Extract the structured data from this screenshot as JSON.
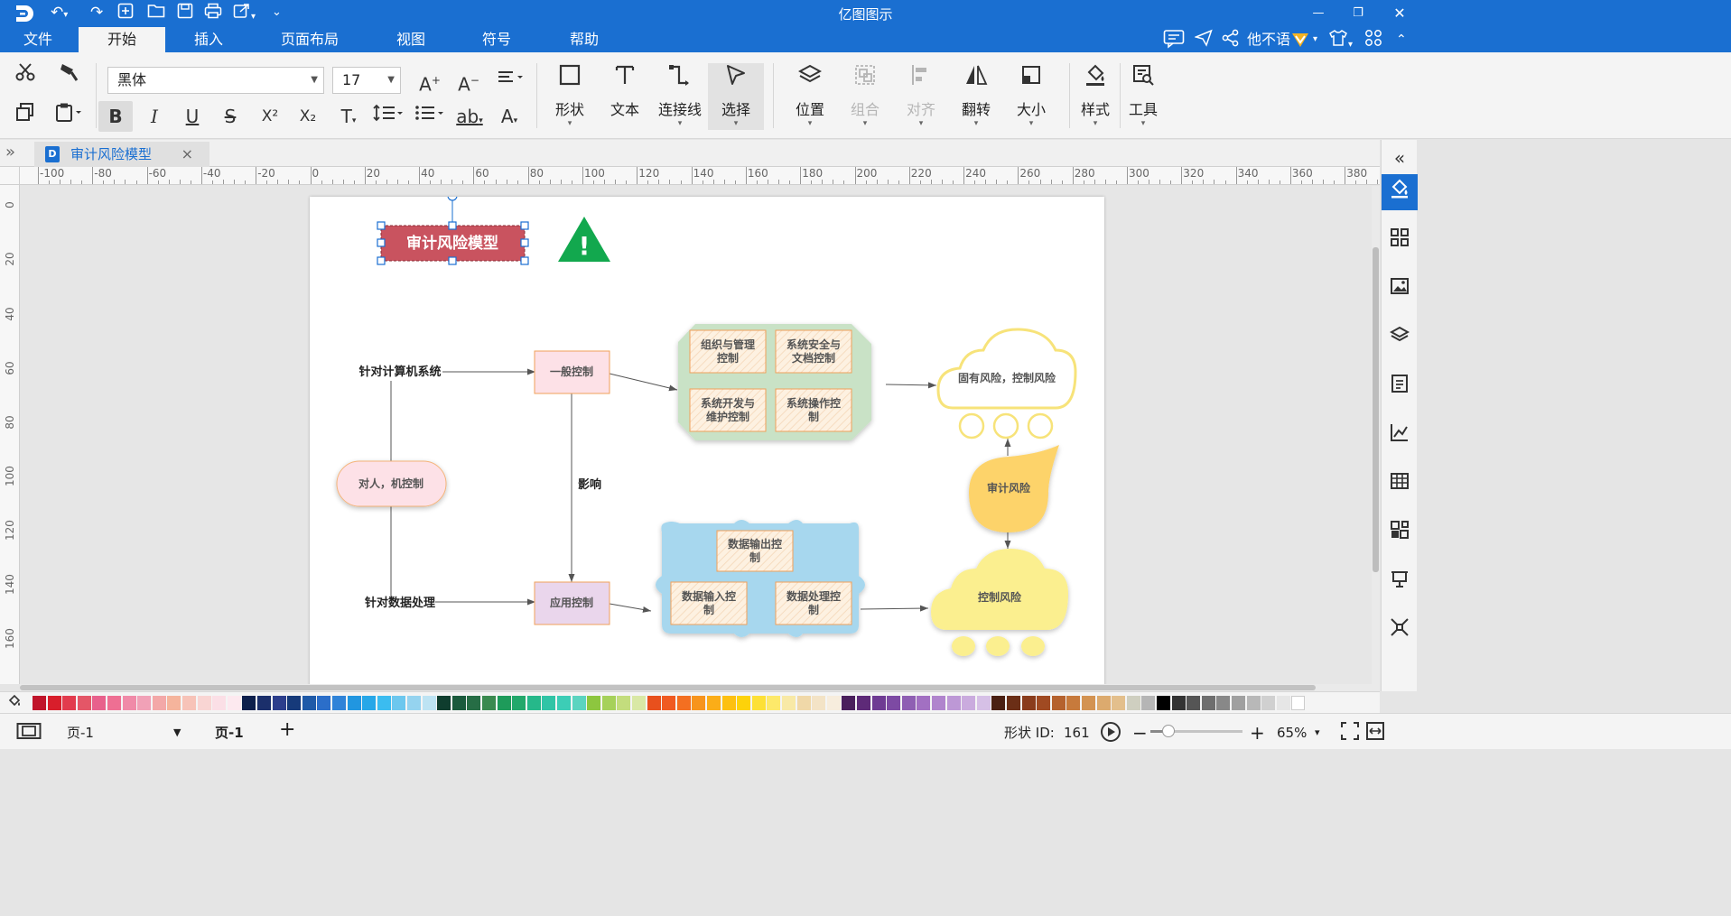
{
  "titlebar": {
    "title": "亿图图示"
  },
  "menu": {
    "items": [
      "文件",
      "开始",
      "插入",
      "页面布局",
      "视图",
      "符号",
      "帮助"
    ],
    "active_index": 1,
    "user_name": "他不语"
  },
  "ribbon": {
    "font_family": "黑体",
    "font_size": "17",
    "big_buttons": {
      "shape": "形状",
      "text": "文本",
      "connector": "连接线",
      "select": "选择",
      "position": "位置",
      "group": "组合",
      "align": "对齐",
      "flip": "翻转",
      "size": "大小",
      "style": "样式",
      "tools": "工具"
    },
    "format_glyphs": {
      "bold": "B",
      "italic": "I",
      "underline": "U",
      "strike": "S",
      "superscript": "X²",
      "subscript": "X₂",
      "text_style": "T",
      "highlight": "ab",
      "font_color": "A"
    }
  },
  "tabs": {
    "document": "审计风险模型"
  },
  "ruler": {
    "horizontal": [
      "-100",
      "-80",
      "-60",
      "-40",
      "-20",
      "0",
      "20",
      "40",
      "60",
      "80",
      "100",
      "120",
      "140",
      "160",
      "180",
      "200",
      "220",
      "240",
      "260",
      "280",
      "300",
      "320",
      "340",
      "360",
      "380"
    ],
    "vertical": [
      "0",
      "20",
      "40",
      "60",
      "80",
      "100",
      "120",
      "140",
      "160"
    ]
  },
  "diagram": {
    "title": "审计风险模型",
    "label_computer": "针对计算机系统",
    "label_data": "针对数据处理",
    "general_control": "一般控制",
    "app_control": "应用控制",
    "person_machine": "对人，机控制",
    "influence": "影响",
    "org_mgmt_1": "组织与管理",
    "org_mgmt_2": "控制",
    "sys_sec_1": "系统安全与",
    "sys_sec_2": "文档控制",
    "sys_dev_1": "系统开发与",
    "sys_dev_2": "维护控制",
    "sys_op_1": "系统操作控",
    "sys_op_2": "制",
    "data_out_1": "数据输出控",
    "data_out_2": "制",
    "data_in_1": "数据输入控",
    "data_in_2": "制",
    "data_proc_1": "数据处理控",
    "data_proc_2": "制",
    "inherent_risk": "固有风险，控制风险",
    "audit_risk": "审计风险",
    "control_risk": "控制风险",
    "warning_glyph": "!"
  },
  "palette": {
    "colors": [
      "#c0142a",
      "#d81e2b",
      "#e23b4d",
      "#e45667",
      "#e8618c",
      "#ee6f93",
      "#f08aa8",
      "#f1a1b7",
      "#f3a8a8",
      "#f5b49c",
      "#f7c3b8",
      "#f9d5d3",
      "#fbdfe6",
      "#fde9ef",
      "#0d1f4c",
      "#1b2f6b",
      "#2c3e8c",
      "#163a7a",
      "#1f5aa8",
      "#2b6ec9",
      "#2f83d8",
      "#2196e0",
      "#26a7e8",
      "#3bbcf0",
      "#6cc7ee",
      "#95d3ef",
      "#bde3f3",
      "#0f3d2e",
      "#1a5a3c",
      "#266d45",
      "#3a8a4f",
      "#1e9b5a",
      "#22a86b",
      "#26b88a",
      "#30c4a6",
      "#3ccdb6",
      "#5bd4c0",
      "#8dc63f",
      "#a6d15a",
      "#c3dd7d",
      "#d9e8a5",
      "#e8501d",
      "#f05a22",
      "#f36f21",
      "#f7941d",
      "#fbad18",
      "#fdc010",
      "#fdd20a",
      "#fde036",
      "#fde96a",
      "#f8e9a6",
      "#f0d8a8",
      "#f3e3c6",
      "#f7eddd",
      "#4a1f5c",
      "#5e2a78",
      "#6f3b93",
      "#7d4aa3",
      "#8f5fb3",
      "#a270c2",
      "#b084cd",
      "#bd98d6",
      "#caabde",
      "#d6c0e6",
      "#4a1f12",
      "#6b2e16",
      "#8a3c1c",
      "#a04a22",
      "#b5622e",
      "#c77a3c",
      "#d39352",
      "#dcaa6e",
      "#e3bf8c",
      "#cfcfc0",
      "#b5b5b5",
      "#000000",
      "#333333",
      "#555555",
      "#6e6e6e",
      "#888888",
      "#a0a0a0",
      "#b8b8b8",
      "#d0d0d0",
      "#e6e6e6",
      "#ffffff"
    ]
  },
  "status": {
    "page_selector": "页-1",
    "page_tab": "页-1",
    "add_page": "+",
    "shape_id_label": "形状 ID:",
    "shape_id": "161",
    "zoom": "65%",
    "zoom_fraction": 0.2
  }
}
